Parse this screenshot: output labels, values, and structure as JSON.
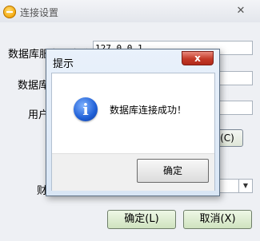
{
  "window": {
    "title": "连接设置",
    "close_glyph": "✕",
    "fields": [
      {
        "label": "数据库服务器名称:",
        "value": "127.0.0.1"
      },
      {
        "label": "数据库",
        "value": ""
      },
      {
        "label": "用户",
        "value": ""
      },
      {
        "label": "财",
        "value": ""
      }
    ],
    "partial_button_label": "(C)",
    "ok_button": "确定(L)",
    "cancel_button": "取消(X)"
  },
  "dialog": {
    "title": "提示",
    "close_glyph": "x",
    "icon": "info-icon",
    "icon_glyph": "i",
    "message": "数据库连接成功！",
    "ok_button": "确定"
  },
  "colors": {
    "close_red": "#c43a28",
    "info_blue": "#1f5fd6",
    "button_green": "#cfe3bf"
  }
}
